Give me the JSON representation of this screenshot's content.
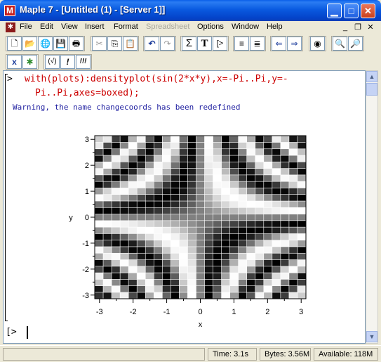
{
  "window": {
    "title": "Maple 7  - [Untitled (1) - [Server 1]]",
    "logo_glyph": "M"
  },
  "menu": {
    "items": [
      {
        "label": "File",
        "enabled": true
      },
      {
        "label": "Edit",
        "enabled": true
      },
      {
        "label": "View",
        "enabled": true
      },
      {
        "label": "Insert",
        "enabled": true
      },
      {
        "label": "Format",
        "enabled": true
      },
      {
        "label": "Spreadsheet",
        "enabled": false
      },
      {
        "label": "Options",
        "enabled": true
      },
      {
        "label": "Window",
        "enabled": true
      },
      {
        "label": "Help",
        "enabled": true
      }
    ]
  },
  "toolbar": {
    "icons": [
      "new-icon",
      "open-icon",
      "open-url-icon",
      "save-icon",
      "print-icon",
      "cut-icon",
      "copy-icon",
      "paste-icon",
      "undo-icon",
      "redo-icon",
      "sum-icon",
      "text-icon",
      "prompt-icon",
      "indent-icon",
      "outdent-icon",
      "back-icon",
      "forward-icon",
      "stop-icon",
      "zoom-in-icon",
      "zoom-out-icon"
    ],
    "sum_glyph": "Σ",
    "text_glyph": "T",
    "prompt_glyph": "[>",
    "context_buttons": [
      "x",
      "✱",
      "(√)",
      "!",
      "!!!"
    ]
  },
  "worksheet": {
    "prompt": ">",
    "command_line1": "with(plots):densityplot(sin(2*x*y),x=-Pi..Pi,y=-",
    "command_line2": "Pi..Pi,axes=boxed);",
    "warning": "Warning, the name changecoords has been redefined",
    "empty_prompt": ">"
  },
  "chart_data": {
    "type": "heatmap",
    "function": "sin(2*x*y)",
    "xlim": [
      -3.14159,
      3.14159
    ],
    "ylim": [
      -3.14159,
      3.14159
    ],
    "grid_points": 25,
    "colormap": "grayscale",
    "xlabel": "x",
    "ylabel": "y",
    "xticks": [
      "-3",
      "-2",
      "-1",
      "0",
      "1",
      "2",
      "3"
    ],
    "yticks": [
      "3",
      "2",
      "1",
      "0",
      "-1",
      "-2",
      "-3"
    ],
    "axes": "boxed"
  },
  "status": {
    "time": "Time:  3.1s",
    "bytes": "Bytes: 3.56M",
    "available": "Available: 118M"
  }
}
